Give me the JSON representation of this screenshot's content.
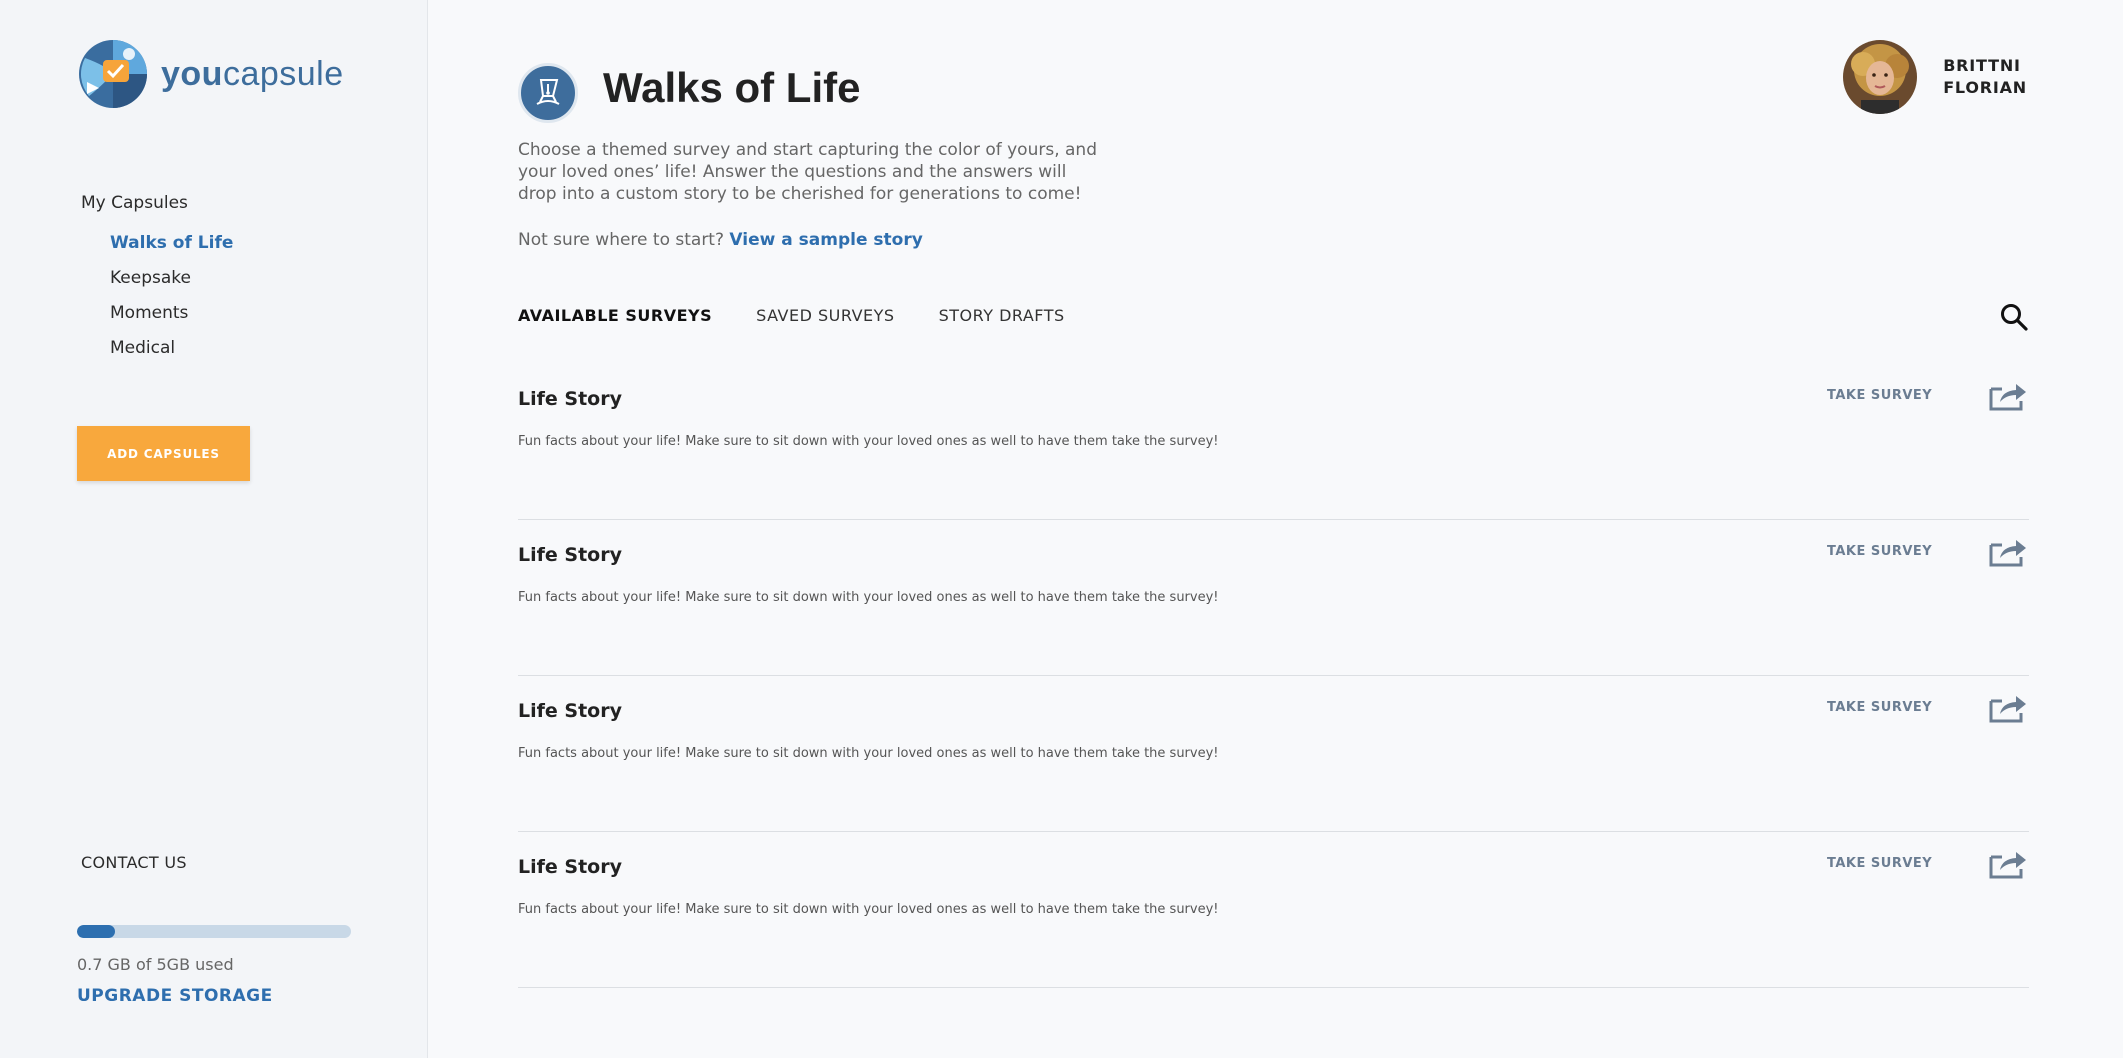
{
  "brand": {
    "name_bold": "you",
    "name_light": "capsule"
  },
  "sidebar": {
    "heading": "My Capsules",
    "items": [
      {
        "label": "Walks of Life",
        "active": true
      },
      {
        "label": "Keepsake",
        "active": false
      },
      {
        "label": "Moments",
        "active": false
      },
      {
        "label": "Medical",
        "active": false
      }
    ],
    "add_button": "ADD CAPSULES",
    "contact": "CONTACT US",
    "storage": {
      "used_fraction": 0.14,
      "text": "0.7 GB of 5GB used"
    },
    "upgrade": "UPGRADE STORAGE"
  },
  "user": {
    "first_name": "BRITTNI",
    "last_name": "FLORIAN"
  },
  "main": {
    "title": "Walks of Life",
    "intro": "Choose a themed survey and start capturing the color of yours, and your loved ones’ life! Answer the questions and the answers will drop into a custom story to be cherished for generations to come!",
    "sample_prefix": "Not sure where to start?",
    "sample_link": "View a sample story",
    "tabs": [
      {
        "label": "AVAILABLE SURVEYS",
        "active": true
      },
      {
        "label": "SAVED SURVEYS",
        "active": false
      },
      {
        "label": "STORY DRAFTS",
        "active": false
      }
    ],
    "surveys": [
      {
        "title": "Life Story",
        "description": "Fun facts about your life! Make sure to sit down with your loved ones as well to have them take the survey!",
        "action": "TAKE SURVEY"
      },
      {
        "title": "Life Story",
        "description": "Fun facts about your life! Make sure to sit down with your loved ones as well to have them take the survey!",
        "action": "TAKE SURVEY"
      },
      {
        "title": "Life Story",
        "description": "Fun facts about your life! Make sure to sit down with your loved ones as well to have them take the survey!",
        "action": "TAKE SURVEY"
      },
      {
        "title": "Life Story",
        "description": "Fun facts about your life! Make sure to sit down with your loved ones as well to have them take the survey!",
        "action": "TAKE SURVEY"
      }
    ]
  },
  "colors": {
    "accent_blue": "#2e6eae",
    "button_orange": "#f8a83d",
    "icon_slate": "#6b7d92"
  },
  "icons": {
    "logo": "globe-logo-icon",
    "page": "pen-nib-icon",
    "search": "search-icon",
    "share": "share-icon"
  }
}
